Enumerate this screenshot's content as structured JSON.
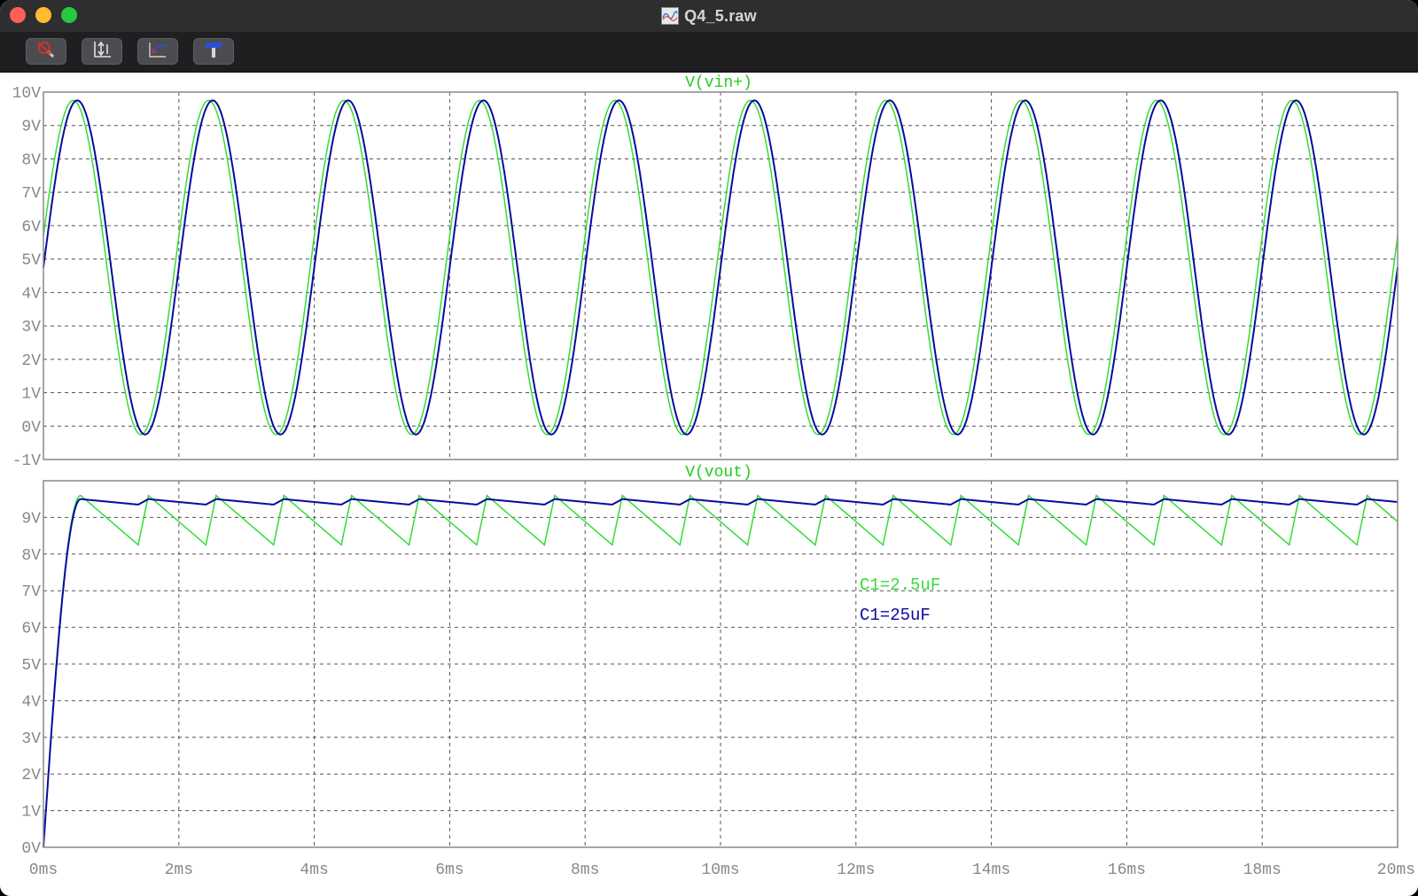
{
  "window": {
    "title": "Q4_5.raw"
  },
  "toolbar": {
    "buttons": [
      {
        "name": "probe-tool-button",
        "icon": "magnifier-cross-icon"
      },
      {
        "name": "autorange-button",
        "icon": "axes-arrows-icon"
      },
      {
        "name": "zoom-back-button",
        "icon": "curve-arrow-icon"
      },
      {
        "name": "settings-button",
        "icon": "hammer-icon"
      }
    ]
  },
  "colors": {
    "vin_trace": "#22cc22",
    "c1_low": "#33dd33",
    "c1_high": "#0a0a9e",
    "grid": "#555555",
    "axis_text": "#888888"
  },
  "chart_data": [
    {
      "type": "line",
      "title": "V(vin+)",
      "xlabel": "",
      "ylabel": "",
      "xlim": [
        0,
        20
      ],
      "ylim": [
        -1,
        10
      ],
      "x_ticks": [
        "0ms",
        "2ms",
        "4ms",
        "6ms",
        "8ms",
        "10ms",
        "12ms",
        "14ms",
        "16ms",
        "18ms",
        "20ms"
      ],
      "y_ticks": [
        "-1V",
        "0V",
        "1V",
        "2V",
        "3V",
        "4V",
        "5V",
        "6V",
        "7V",
        "8V",
        "9V",
        "10V"
      ],
      "grid": true,
      "signal": {
        "waveform": "sine",
        "frequency_khz": 0.5,
        "offset_v": 4.75,
        "amplitude_v": 5.0,
        "clip_low_v": -0.25
      },
      "series": [
        {
          "name": "",
          "color": "#33dd33",
          "phase_shift_ms": -0.06
        },
        {
          "name": "",
          "color": "#0a0a9e",
          "phase_shift_ms": 0.0
        }
      ]
    },
    {
      "type": "line",
      "title": "V(vout)",
      "xlabel": "",
      "ylabel": "",
      "xlim": [
        0,
        20
      ],
      "ylim": [
        0,
        10
      ],
      "x_ticks": [
        "0ms",
        "2ms",
        "4ms",
        "6ms",
        "8ms",
        "10ms",
        "12ms",
        "14ms",
        "16ms",
        "18ms",
        "20ms"
      ],
      "y_ticks": [
        "0V",
        "1V",
        "2V",
        "3V",
        "4V",
        "5V",
        "6V",
        "7V",
        "8V",
        "9V",
        "10V"
      ],
      "grid": true,
      "legend": [
        "C1=2.5uF",
        "C1=25uF"
      ],
      "series": [
        {
          "name": "C1=2.5uF",
          "color": "#33dd33",
          "peak_v": 9.6,
          "valley_v": 8.25,
          "ripple_period_ms": 1.0
        },
        {
          "name": "C1=25uF",
          "color": "#0a0a9e",
          "peak_v": 9.5,
          "valley_v": 9.35,
          "ripple_period_ms": 1.0
        }
      ]
    }
  ]
}
